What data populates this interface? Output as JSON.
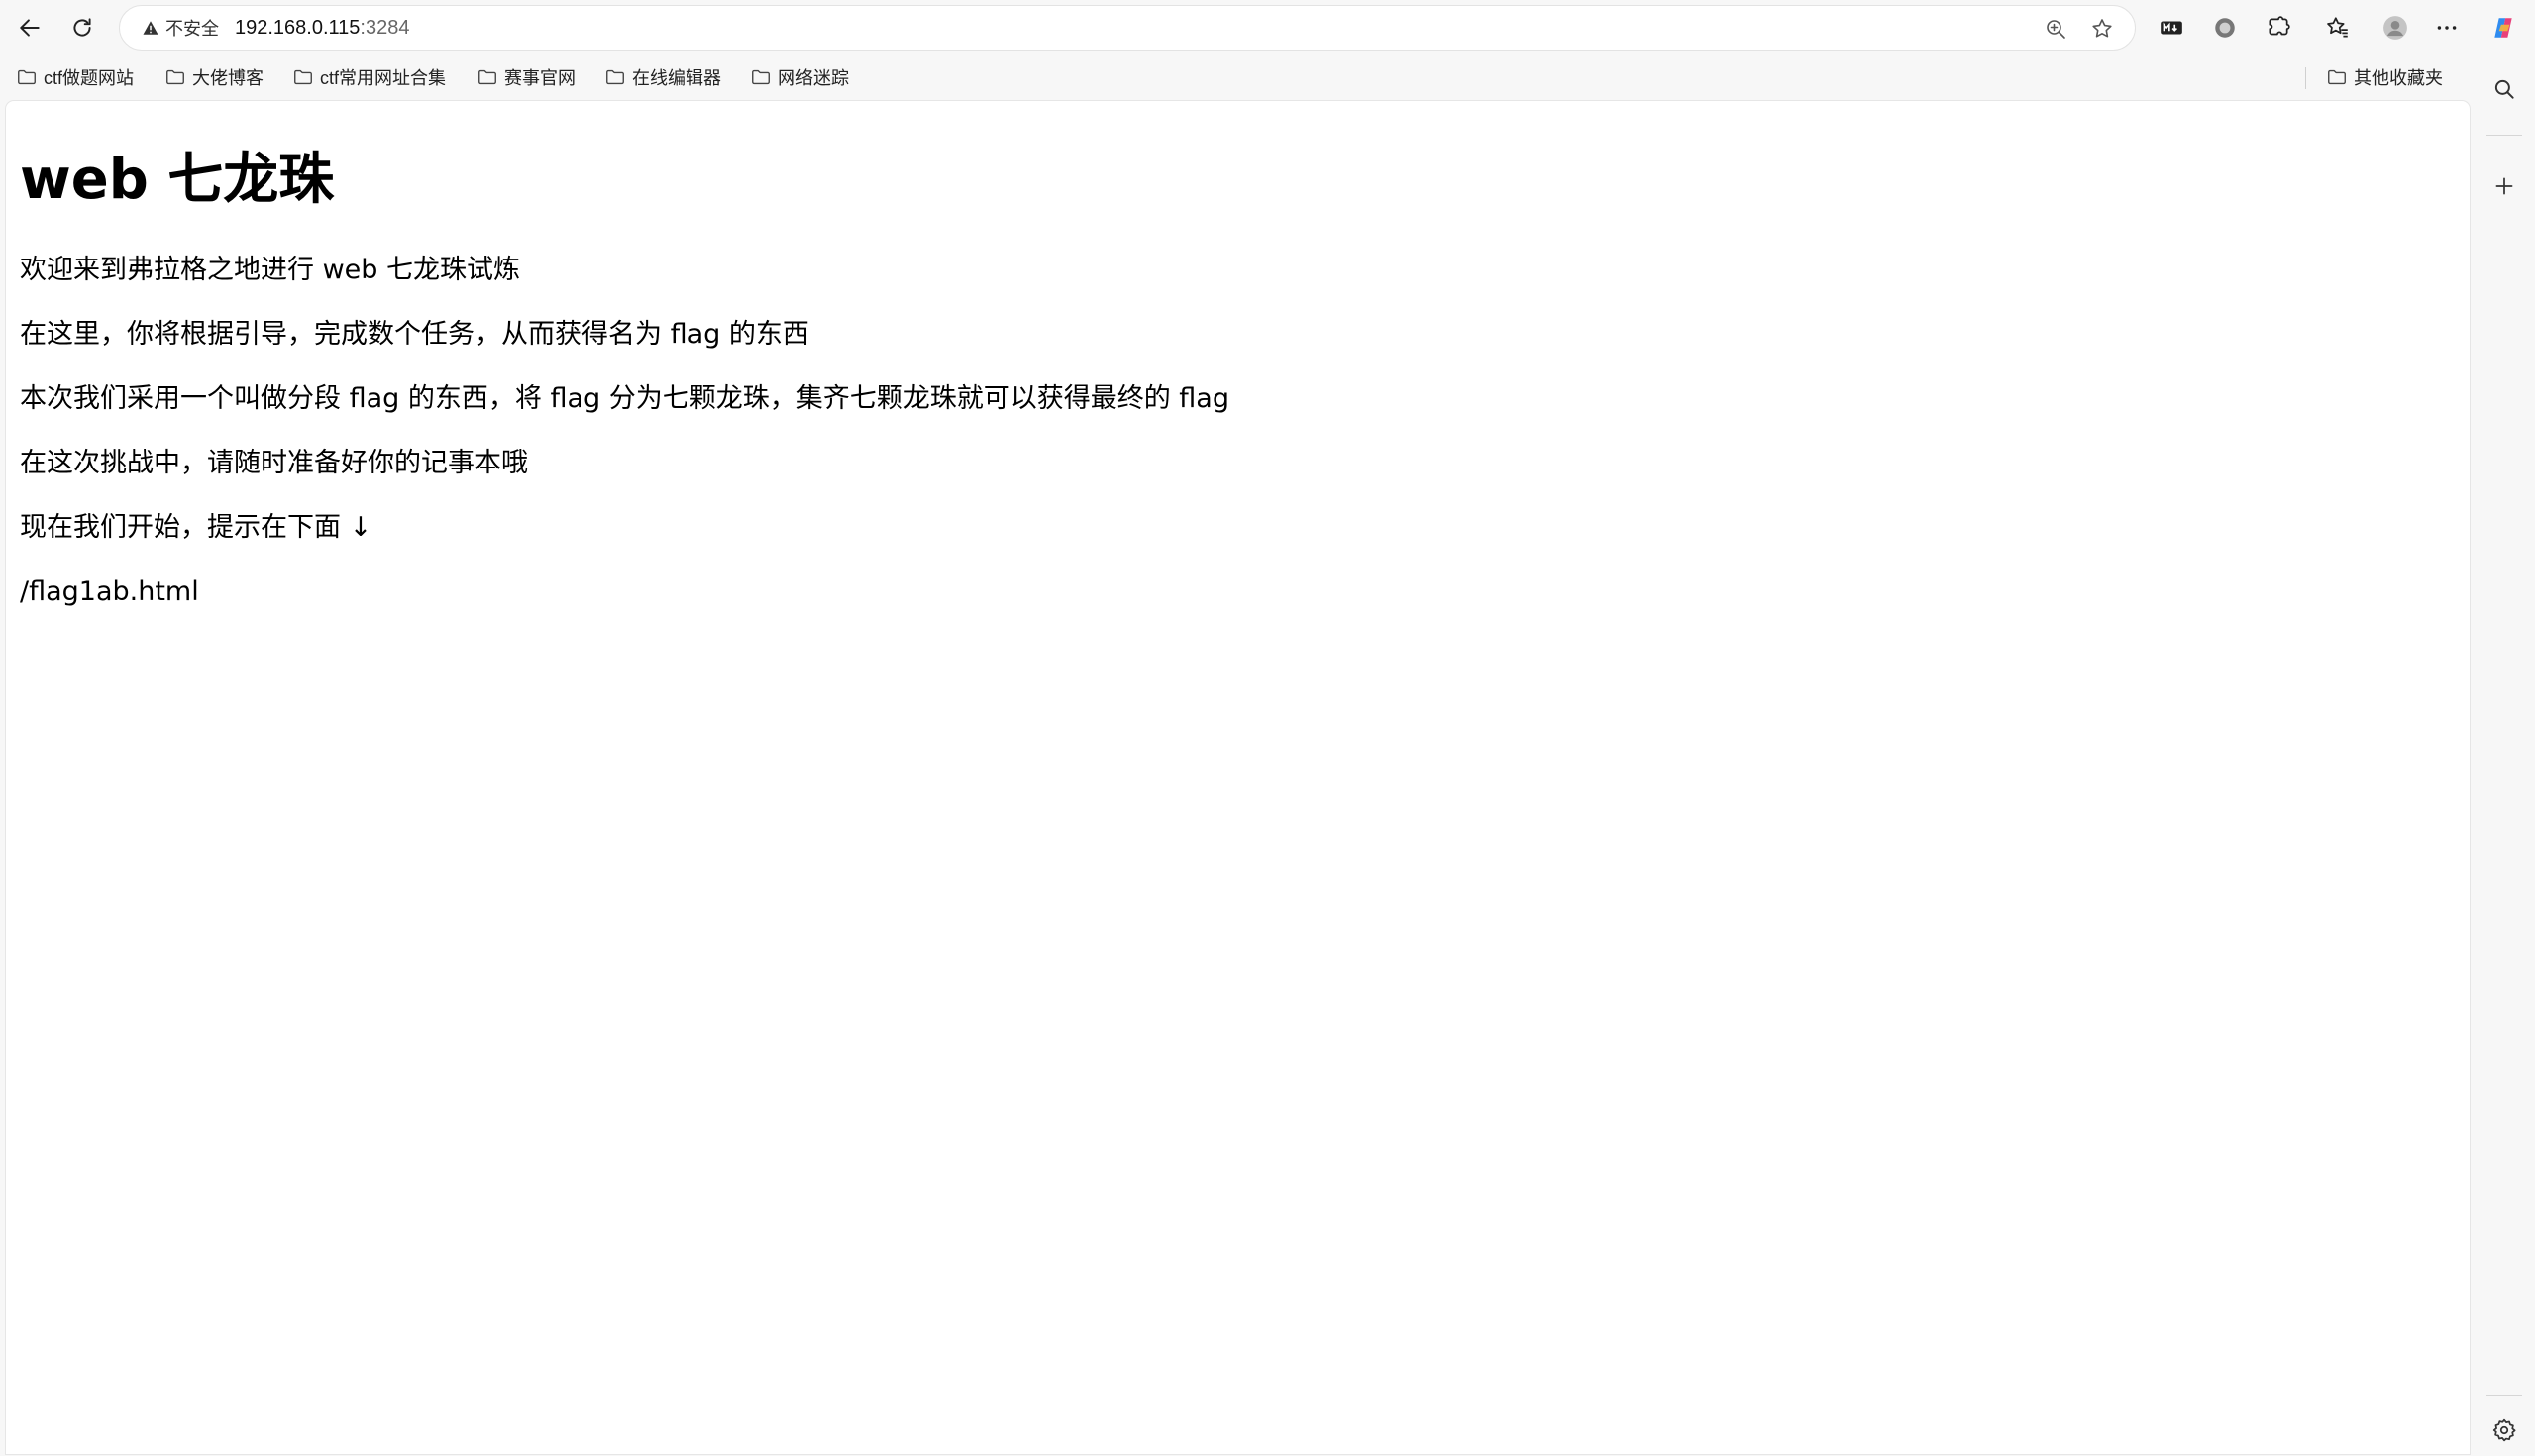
{
  "browser": {
    "security_label": "不安全",
    "url_host": "192.168.0.115",
    "url_port": ":3284"
  },
  "bookmarks": [
    {
      "label": "ctf做题网站"
    },
    {
      "label": "大佬博客"
    },
    {
      "label": "ctf常用网址合集"
    },
    {
      "label": "赛事官网"
    },
    {
      "label": "在线编辑器"
    },
    {
      "label": "网络迷踪"
    }
  ],
  "other_bookmarks": "其他收藏夹",
  "page": {
    "title": "web 七龙珠",
    "paragraphs": [
      "欢迎来到弗拉格之地进行 web 七龙珠试炼",
      "在这里，你将根据引导，完成数个任务，从而获得名为 flag 的东西",
      "本次我们采用一个叫做分段 flag 的东西，将 flag 分为七颗龙珠，集齐七颗龙珠就可以获得最终的 flag",
      "在这次挑战中，请随时准备好你的记事本哦",
      "现在我们开始，提示在下面 ↓",
      "/flag1ab.html"
    ]
  },
  "icons": {
    "back": "back-arrow-icon",
    "refresh": "refresh-icon",
    "warning": "warning-icon",
    "zoom": "zoom-in-icon",
    "favorite": "star-icon",
    "markdown": "markdown-extension-icon",
    "record": "record-extension-icon",
    "extensions": "puzzle-icon",
    "favorites": "favorites-icon",
    "profile": "profile-avatar-icon",
    "more": "more-icon",
    "copilot": "copilot-icon",
    "search": "search-icon",
    "add": "plus-icon",
    "settings": "gear-icon",
    "folder": "folder-icon"
  }
}
